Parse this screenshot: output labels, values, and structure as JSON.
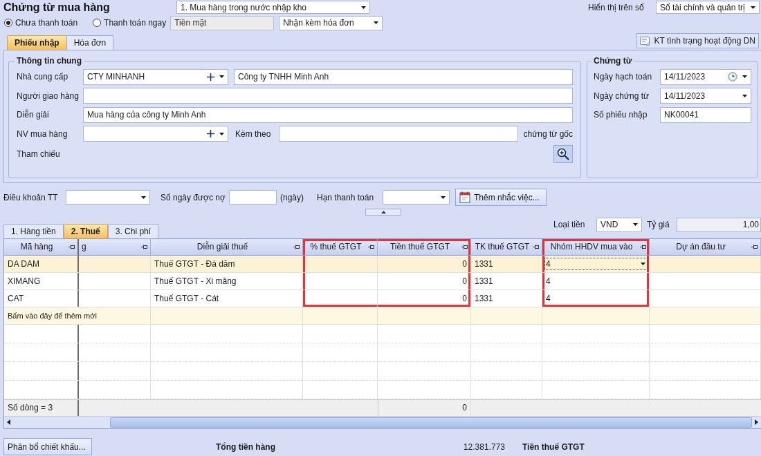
{
  "header": {
    "title": "Chứng từ mua hàng",
    "voucher_type": "1. Mua hàng trong nước nhập kho",
    "ledger_label": "Hiển thị trên sổ",
    "ledger": "Sổ tài chính và quản trị"
  },
  "payment": {
    "options": [
      {
        "label": "Chưa thanh toán",
        "selected": true
      },
      {
        "label": "Thanh toán ngay",
        "selected": false
      }
    ],
    "method": {
      "value": "Tiền mặt",
      "disabled": true
    },
    "invoice": "Nhận kèm hóa đơn"
  },
  "form_tabs": [
    {
      "label": "Phiếu nhập",
      "selected": true
    },
    {
      "label": "Hóa đơn",
      "selected": false
    }
  ],
  "check_button": "KT tình trạng hoạt động DN",
  "general": {
    "title": "Thông tin chung",
    "supplier": {
      "label": "Nhà cung cấp",
      "code": "CTY MINHANH",
      "name": "Công ty TNHH Minh Anh"
    },
    "deliverer_label": "Người giao hàng",
    "description": {
      "label": "Diễn giải",
      "value": "Mua hàng của công ty Minh Anh"
    },
    "buyer_label": "NV mua hàng",
    "attachments": {
      "label": "Kèm theo",
      "suffix": "chứng từ gốc"
    },
    "reference_label": "Tham chiếu"
  },
  "voucher": {
    "title": "Chứng từ",
    "fields": [
      {
        "label": "Ngày hạch toán",
        "value": "14/11/2023",
        "kind": "datetime"
      },
      {
        "label": "Ngày chứng từ",
        "value": "14/11/2023",
        "kind": "date"
      },
      {
        "label": "Số phiếu nhập",
        "value": "NK00041",
        "kind": "text"
      }
    ]
  },
  "terms": {
    "payment_terms_label": "Điều khoản TT",
    "days_label": "Số ngày được nợ",
    "days_unit": "(ngày)",
    "due_label": "Hạn thanh toán",
    "reminder_button": "Thêm nhắc việc..."
  },
  "grid_tabs": [
    {
      "label": "1. Hàng tiền",
      "selected": false
    },
    {
      "label": "2. Thuế",
      "selected": true
    },
    {
      "label": "3. Chi phí",
      "selected": false
    }
  ],
  "currency": {
    "label": "Loại tiền",
    "value": "VND",
    "rate_label": "Tỷ giá",
    "rate": "1,00"
  },
  "table": {
    "columns": [
      {
        "label": "Mã hàng",
        "kind": "text",
        "highlighted": false
      },
      {
        "label": "g",
        "kind": "clipped",
        "highlighted": false
      },
      {
        "label": "Diễn giải thuế",
        "kind": "text",
        "highlighted": false
      },
      {
        "label": "% thuế GTGT",
        "kind": "text",
        "highlighted": true
      },
      {
        "label": "Tiền thuế GTGT",
        "kind": "amount",
        "highlighted": true
      },
      {
        "label": "TK thuế GTGT",
        "kind": "text",
        "highlighted": false
      },
      {
        "label": "Nhóm HHDV mua vào",
        "kind": "combo",
        "highlighted": true
      },
      {
        "label": "Dự án đầu tư",
        "kind": "text",
        "highlighted": false
      }
    ],
    "rows": [
      {
        "code": "DA DAM",
        "description": "Thuế GTGT - Đá dăm",
        "tax_amount": "0",
        "account": "1331",
        "group": "4",
        "selected": true
      },
      {
        "code": "XIMANG",
        "description": "Thuế GTGT - Xi măng",
        "tax_amount": "0",
        "account": "1331",
        "group": "4",
        "selected": false
      },
      {
        "code": "CAT",
        "description": "Thuế GTGT - Cát",
        "tax_amount": "0",
        "account": "1331",
        "group": "4",
        "selected": false
      }
    ],
    "new_row_hint": "Bấm vào đây để thêm mới",
    "footer": {
      "count": "Số dòng = 3",
      "total": "0"
    }
  },
  "summary": {
    "discount_button": "Phân bổ chiết khấu...",
    "goods_total_label": "Tổng tiền hàng",
    "goods_total": "12.381.773",
    "vat_label": "Tiền thuế GTGT"
  }
}
